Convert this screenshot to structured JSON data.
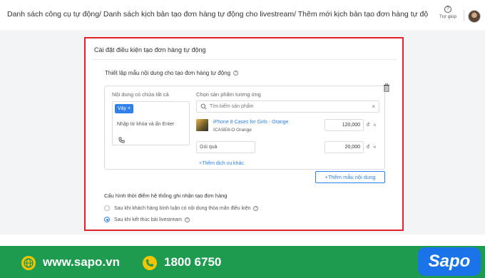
{
  "header": {
    "breadcrumb": "Danh sách công cụ tự động/ Danh sách kịch bản tạo đơn hàng tự động cho livestream/ Thêm mới kịch bản tạo đơn hàng tự động",
    "help_label": "Trợ giúp"
  },
  "card": {
    "title": "Cài đặt điều kiện tạo đơn hàng tự động",
    "section_title": "Thiết lập mẫu nội dung cho tạo đơn hàng tự động",
    "keywords": {
      "label": "Nội dung có chứa tất cả",
      "tag": "Váy",
      "placeholder": "Nhập từ khóa và ấn Enter"
    },
    "products": {
      "label": "Chọn sản phẩm tương ứng",
      "search_placeholder": "Tìm kiếm sản phẩm",
      "items": [
        {
          "name": "iPhone 8 Cases for Girls - Orange",
          "sku": "ICASE8-O Orange",
          "price": "120,000",
          "currency": "đ"
        }
      ],
      "gift": {
        "value": "Gói quà",
        "price": "20,000",
        "currency": "đ"
      },
      "add_service": "Thêm dịch vụ khác"
    },
    "add_template_button": "Thêm mẫu nội dung",
    "config": {
      "title": "Cấu hình thời điểm hệ thống ghi nhận tạo đơn hàng",
      "options": [
        {
          "label": "Sau khi khách hàng bình luận có nội dung thỏa mãn điều kiện",
          "selected": false
        },
        {
          "label": "Sau khi kết thúc bài livestream",
          "selected": true
        }
      ]
    }
  },
  "footer": {
    "website": "www.sapo.vn",
    "phone": "1800 6750",
    "brand": "Sapo"
  },
  "colors": {
    "accent_blue": "#2f80ed",
    "highlight_red": "#e0242b",
    "footer_green": "#1e9b4e",
    "badge_yellow": "#f5c400"
  }
}
